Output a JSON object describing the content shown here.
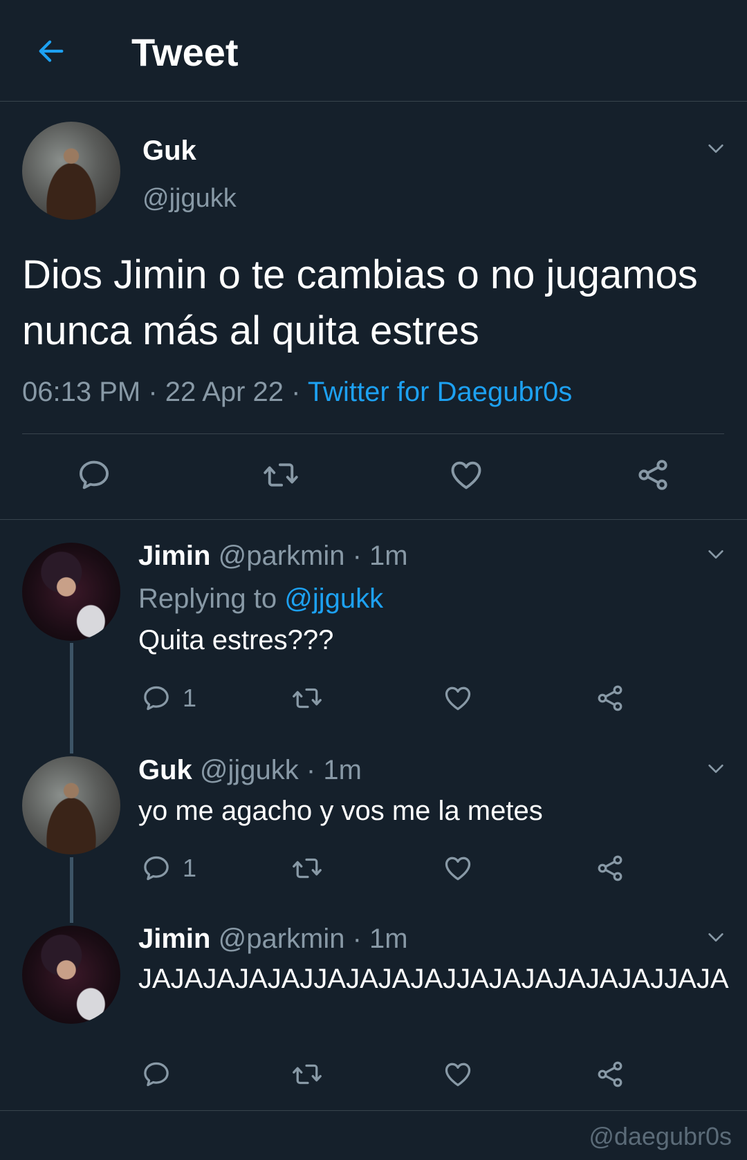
{
  "header": {
    "title": "Tweet"
  },
  "main_tweet": {
    "name": "Guk",
    "handle": "@jjgukk",
    "text": "Dios Jimin o te cambias o no jugamos nunca más al quita estres",
    "time": "06:13 PM",
    "date": "22 Apr 22",
    "separator": "·",
    "source": "Twitter for Daegubr0s"
  },
  "replies": [
    {
      "name": "Jimin",
      "handle": "@parkmin",
      "age": "· 1m",
      "replying_label": "Replying to",
      "replying_to": "@jjgukk",
      "text": "Quita estres???",
      "reply_count": "1"
    },
    {
      "name": "Guk",
      "handle": "@jjgukk",
      "age": "· 1m",
      "text": "yo me agacho y vos me la metes",
      "reply_count": "1"
    },
    {
      "name": "Jimin",
      "handle": "@parkmin",
      "age": "· 1m",
      "text": "JAJAJAJAJAJJAJAJAJAJJAJAJAJAJAJAJJAJA",
      "reply_count": ""
    }
  ],
  "watermark": "@daegubr0s",
  "icons": {
    "back": "arrow-left-icon",
    "caret": "chevron-down-icon",
    "reply": "comment-icon",
    "retweet": "retweet-icon",
    "like": "heart-icon",
    "share": "share-icon"
  },
  "colors": {
    "background": "#15202b",
    "accent": "#1da1f2",
    "secondary_text": "#8899a6",
    "divider": "#38444d"
  }
}
